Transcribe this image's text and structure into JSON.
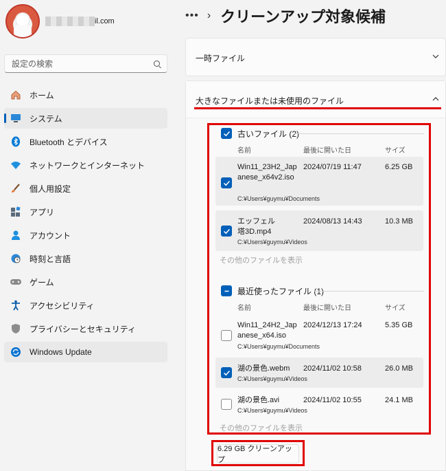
{
  "sidebar": {
    "email_suffix": "il.com",
    "search_placeholder": "設定の検索",
    "items": [
      {
        "label": "ホーム",
        "icon": "home-icon"
      },
      {
        "label": "システム",
        "icon": "system-icon"
      },
      {
        "label": "Bluetooth とデバイス",
        "icon": "bluetooth-icon"
      },
      {
        "label": "ネットワークとインターネット",
        "icon": "network-icon"
      },
      {
        "label": "個人用設定",
        "icon": "brush-icon"
      },
      {
        "label": "アプリ",
        "icon": "apps-icon"
      },
      {
        "label": "アカウント",
        "icon": "account-icon"
      },
      {
        "label": "時刻と言語",
        "icon": "globe-clock-icon"
      },
      {
        "label": "ゲーム",
        "icon": "gamepad-icon"
      },
      {
        "label": "アクセシビリティ",
        "icon": "accessibility-icon"
      },
      {
        "label": "プライバシーとセキュリティ",
        "icon": "shield-icon"
      },
      {
        "label": "Windows Update",
        "icon": "windows-update-icon"
      }
    ],
    "active_index": 1
  },
  "header": {
    "dots": "•••",
    "chevron": "›",
    "title": "クリーンアップ対象候補"
  },
  "sections": {
    "temp_files": "一時ファイル",
    "large_files": "大きなファイルまたは未使用のファイル"
  },
  "columns": {
    "name": "名前",
    "last_opened": "最後に開いた日",
    "size": "サイズ"
  },
  "groups": [
    {
      "label": "古いファイル (2)",
      "state": "checked",
      "files": [
        {
          "name": "Win11_23H2_Japanese_x64v2.iso",
          "date": "2024/07/19 11:47",
          "size": "6.25 GB",
          "path": "C:¥Users¥guymu¥Documents",
          "checked": true
        },
        {
          "name": "エッフェル塔3D.mp4",
          "date": "2024/08/13 14:43",
          "size": "10.3 MB",
          "path": "C:¥Users¥guymu¥Videos",
          "checked": true
        }
      ],
      "more": "その他のファイルを表示"
    },
    {
      "label": "最近使ったファイル (1)",
      "state": "indeterminate",
      "files": [
        {
          "name": "Win11_24H2_Japanese_x64.iso",
          "date": "2024/12/13 17:24",
          "size": "5.35 GB",
          "path": "C:¥Users¥guymu¥Documents",
          "checked": false
        },
        {
          "name": "湖の景色.webm",
          "date": "2024/11/02 10:58",
          "size": "26.0 MB",
          "path": "C:¥Users¥guymu¥Videos",
          "checked": true
        },
        {
          "name": "湖の景色.avi",
          "date": "2024/11/02 10:55",
          "size": "24.1 MB",
          "path": "C:¥Users¥guymu¥Videos",
          "checked": false
        }
      ],
      "more": "その他のファイルを表示"
    }
  ],
  "cleanup_button": "6.29 GB クリーンアップ",
  "colors": {
    "accent": "#005fb8",
    "highlight": "#e00000"
  }
}
